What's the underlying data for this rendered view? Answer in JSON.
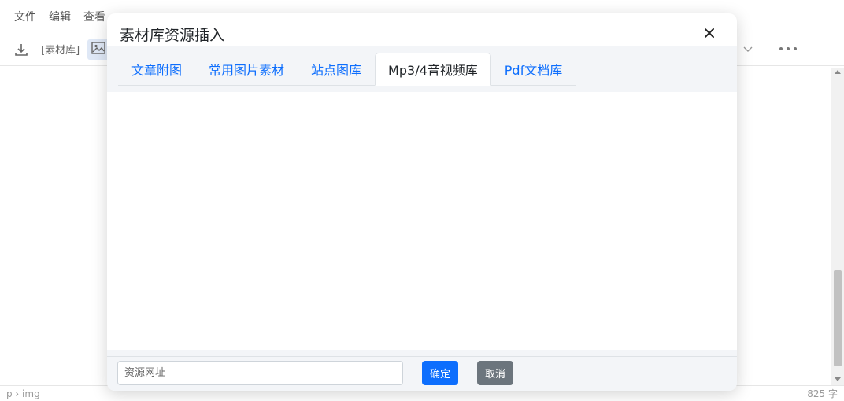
{
  "editor": {
    "menu": [
      "文件",
      "编辑",
      "查看"
    ],
    "toolbar": {
      "download_icon": "download-icon",
      "material_label": "[素材库]",
      "image_icon": "image-icon",
      "more_icon": "more-horizontal-icon"
    },
    "statusbar": {
      "path": "p › img",
      "word_count": "825 字"
    }
  },
  "modal": {
    "title": "素材库资源插入",
    "close_icon": "close-icon",
    "tabs": [
      {
        "label": "文章附图",
        "active": false
      },
      {
        "label": "常用图片素材",
        "active": false
      },
      {
        "label": "站点图库",
        "active": false
      },
      {
        "label": "Mp3/4音视频库",
        "active": true
      },
      {
        "label": "Pdf文档库",
        "active": false
      }
    ],
    "footer": {
      "url_placeholder": "资源网址",
      "url_value": "",
      "confirm_label": "确定",
      "cancel_label": "取消"
    }
  },
  "colors": {
    "accent": "#0d6efd",
    "secondary": "#6c757d",
    "panel_bg": "#f3f5f8"
  }
}
